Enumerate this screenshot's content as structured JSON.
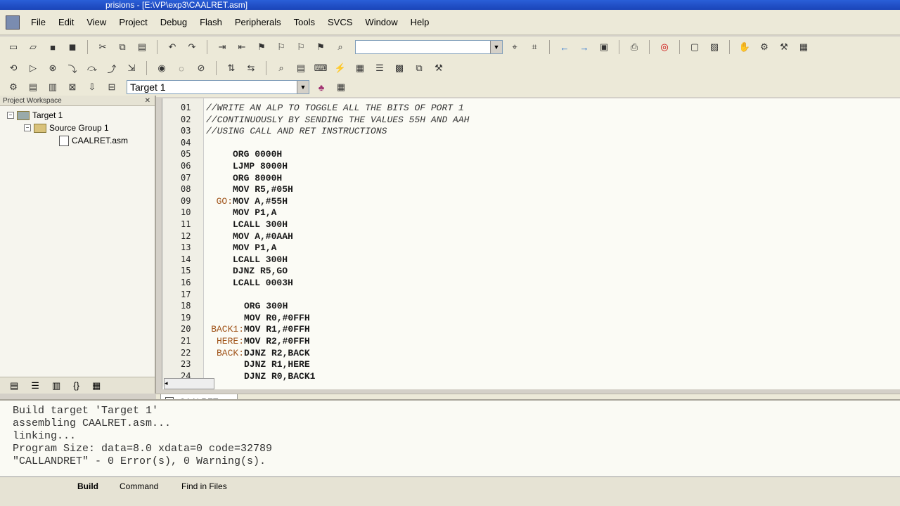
{
  "window": {
    "title": "prisions - [E:\\VP\\exp3\\CAALRET.asm]"
  },
  "menu": [
    "File",
    "Edit",
    "View",
    "Project",
    "Debug",
    "Flash",
    "Peripherals",
    "Tools",
    "SVCS",
    "Window",
    "Help"
  ],
  "toolbar": {
    "target_combo": "Target 1",
    "search_value": ""
  },
  "workspace": {
    "title": "Project Workspace",
    "tree": {
      "target": "Target 1",
      "group": "Source Group 1",
      "file": "CAALRET.asm"
    }
  },
  "editor": {
    "tab_label": "CAALRET",
    "line_numbers": [
      "01",
      "02",
      "03",
      "04",
      "05",
      "06",
      "07",
      "08",
      "09",
      "10",
      "11",
      "12",
      "13",
      "14",
      "15",
      "16",
      "17",
      "18",
      "19",
      "20",
      "21",
      "22",
      "23",
      "24"
    ],
    "lines": [
      {
        "label": "",
        "text": "//WRITE AN ALP TO TOGGLE ALL THE BITS OF PORT 1",
        "comment": true
      },
      {
        "label": "",
        "text": "//CONTINUOUSLY BY SENDING THE VALUES 55H AND AAH",
        "comment": true
      },
      {
        "label": "",
        "text": "//USING CALL AND RET INSTRUCTIONS",
        "comment": true
      },
      {
        "label": "",
        "text": "",
        "comment": false
      },
      {
        "label": "",
        "text": "ORG 0000H",
        "comment": false
      },
      {
        "label": "",
        "text": "LJMP 8000H",
        "comment": false
      },
      {
        "label": "",
        "text": "ORG 8000H",
        "comment": false
      },
      {
        "label": "",
        "text": "MOV R5,#05H",
        "comment": false
      },
      {
        "label": "GO:",
        "text": "MOV A,#55H",
        "comment": false
      },
      {
        "label": "",
        "text": "MOV P1,A",
        "comment": false
      },
      {
        "label": "",
        "text": "LCALL 300H",
        "comment": false
      },
      {
        "label": "",
        "text": "MOV A,#0AAH",
        "comment": false
      },
      {
        "label": "",
        "text": "MOV P1,A",
        "comment": false
      },
      {
        "label": "",
        "text": "LCALL 300H",
        "comment": false
      },
      {
        "label": "",
        "text": "DJNZ R5,GO",
        "comment": false
      },
      {
        "label": "",
        "text": "LCALL 0003H",
        "comment": false
      },
      {
        "label": "",
        "text": "",
        "comment": false
      },
      {
        "label": "",
        "text": "ORG 300H",
        "comment": false
      },
      {
        "label": "",
        "text": "MOV R0,#0FFH",
        "comment": false
      },
      {
        "label": "BACK1:",
        "text": "MOV R1,#0FFH",
        "comment": false
      },
      {
        "label": "HERE:",
        "text": "MOV R2,#0FFH",
        "comment": false
      },
      {
        "label": "BACK:",
        "text": "DJNZ R2,BACK",
        "comment": false
      },
      {
        "label": "",
        "text": "DJNZ R1,HERE",
        "comment": false
      },
      {
        "label": "",
        "text": "DJNZ R0,BACK1",
        "comment": false
      }
    ]
  },
  "output": {
    "lines": [
      "Build target 'Target 1'",
      "assembling CAALRET.asm...",
      "linking...",
      "Program Size: data=8.0 xdata=0 code=32789",
      "\"CALLANDRET\" - 0 Error(s), 0 Warning(s)."
    ]
  },
  "bottom_tabs": [
    "Build",
    "Command",
    "Find in Files"
  ]
}
